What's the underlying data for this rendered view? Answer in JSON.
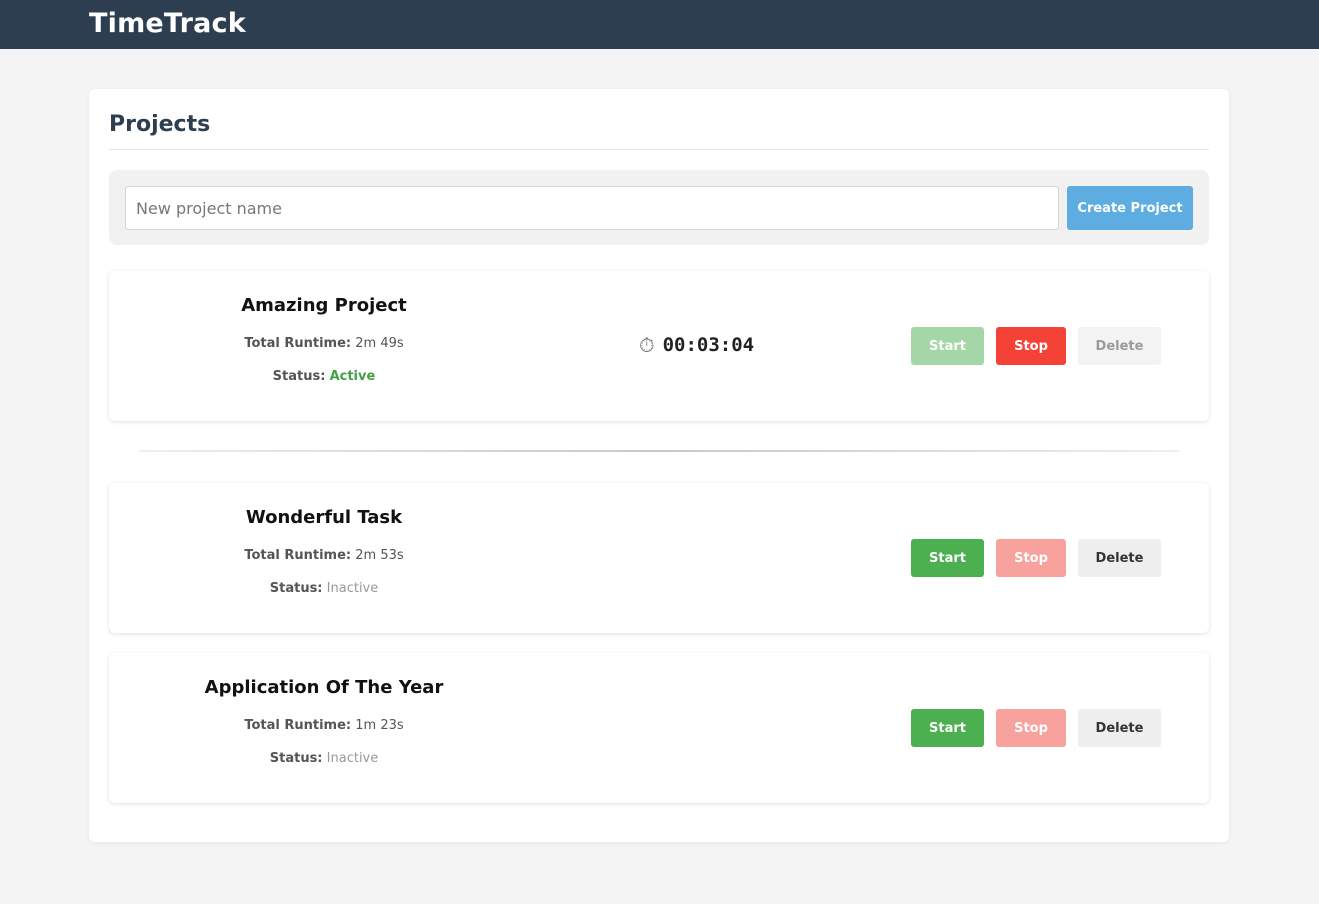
{
  "app": {
    "title": "TimeTrack"
  },
  "projects_panel": {
    "title": "Projects",
    "new_project": {
      "placeholder": "New project name",
      "value": "",
      "button_label": "Create Project"
    }
  },
  "labels": {
    "total_runtime": "Total Runtime:",
    "status": "Status:",
    "start": "Start",
    "stop": "Stop",
    "delete": "Delete",
    "timer_icon": "⏱"
  },
  "projects": [
    {
      "name": "Amazing Project",
      "runtime": "2m 49s",
      "status": "Active",
      "timer": "00:03:04",
      "start_enabled": false,
      "stop_enabled": true,
      "delete_enabled": false
    },
    {
      "name": "Wonderful Task",
      "runtime": "2m 53s",
      "status": "Inactive",
      "start_enabled": true,
      "stop_enabled": false,
      "delete_enabled": true
    },
    {
      "name": "Application Of The Year",
      "runtime": "1m 23s",
      "status": "Inactive",
      "start_enabled": true,
      "stop_enabled": false,
      "delete_enabled": true
    }
  ],
  "colors": {
    "header_bg": "#2c3e50",
    "active": "#43a047",
    "start": "#4caf50",
    "stop": "#f44336",
    "create": "#5dade2"
  }
}
